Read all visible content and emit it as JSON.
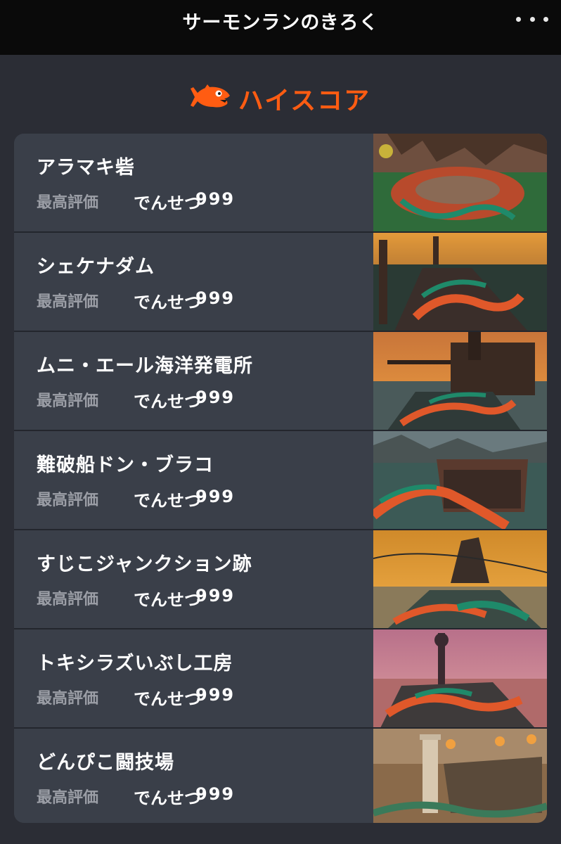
{
  "header": {
    "title": "サーモンランのきろく",
    "menu_icon": "more-dots-icon"
  },
  "section": {
    "title": "ハイスコア",
    "icon": "salmon-fish-icon",
    "accent_color": "#ff5c12"
  },
  "stages": [
    {
      "name": "アラマキ砦",
      "label": "最高評価",
      "grade": "でんせつ",
      "score": "999",
      "thumbnail_icon": "stage-thumbnail"
    },
    {
      "name": "シェケナダム",
      "label": "最高評価",
      "grade": "でんせつ",
      "score": "999",
      "thumbnail_icon": "stage-thumbnail"
    },
    {
      "name": "ムニ・エール海洋発電所",
      "label": "最高評価",
      "grade": "でんせつ",
      "score": "999",
      "thumbnail_icon": "stage-thumbnail"
    },
    {
      "name": "難破船ドン・ブラコ",
      "label": "最高評価",
      "grade": "でんせつ",
      "score": "999",
      "thumbnail_icon": "stage-thumbnail"
    },
    {
      "name": "すじこジャンクション跡",
      "label": "最高評価",
      "grade": "でんせつ",
      "score": "999",
      "thumbnail_icon": "stage-thumbnail"
    },
    {
      "name": "トキシラズいぶし工房",
      "label": "最高評価",
      "grade": "でんせつ",
      "score": "999",
      "thumbnail_icon": "stage-thumbnail"
    },
    {
      "name": "どんぴこ闘技場",
      "label": "最高評価",
      "grade": "でんせつ",
      "score": "999",
      "thumbnail_icon": "stage-thumbnail"
    }
  ]
}
